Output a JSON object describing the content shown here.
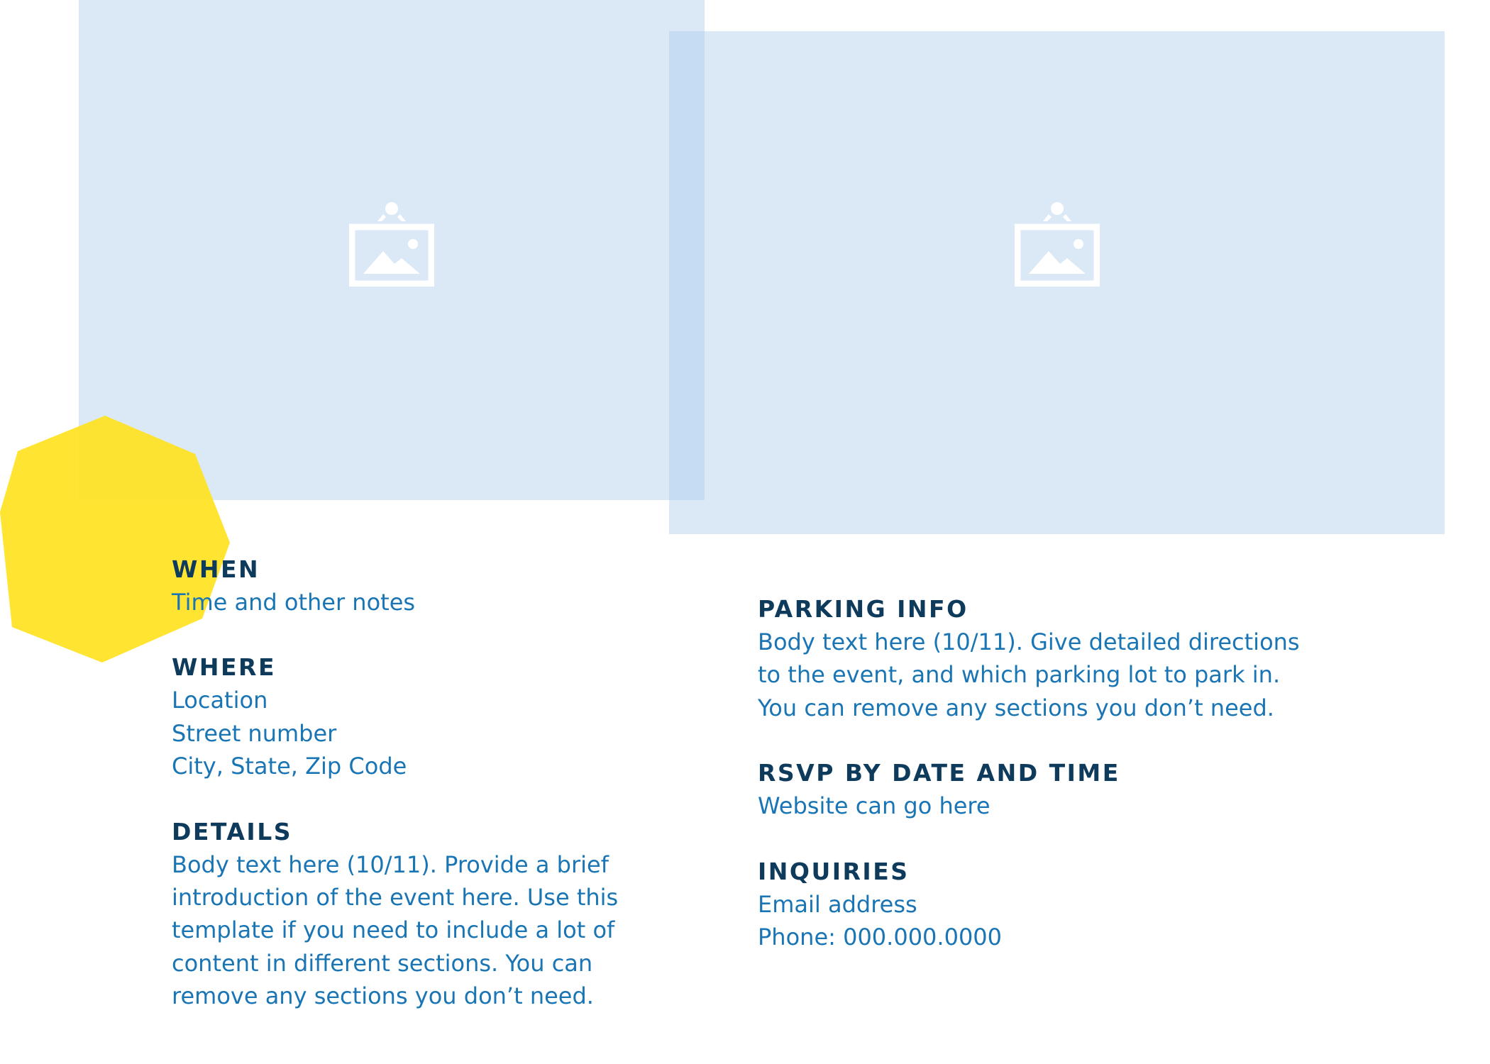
{
  "left_column": {
    "when": {
      "heading": "WHEN",
      "lines": [
        "Time and other notes"
      ]
    },
    "where": {
      "heading": "WHERE",
      "lines": [
        "Location",
        "Street number",
        "City, State, Zip Code"
      ]
    },
    "details": {
      "heading": "DETAILS",
      "lines": [
        "Body text here (10/11). Provide a brief",
        "introduction of the event here. Use this",
        "template if you need to include a lot of",
        "content in different sections. You can",
        "remove any sections you don’t need."
      ]
    }
  },
  "right_column": {
    "parking": {
      "heading": "PARKING INFO",
      "lines": [
        "Body text here (10/11).  Give detailed directions",
        "to the event, and which parking lot to park in.",
        "You can remove any sections you don’t need."
      ]
    },
    "rsvp": {
      "heading": "RSVP BY DATE AND TIME",
      "lines": [
        "Website can go here"
      ]
    },
    "inquiries": {
      "heading": "INQUIRIES",
      "lines": [
        "Email address",
        "Phone: 000.000.0000"
      ]
    }
  },
  "colors": {
    "heading": "#0e3a5c",
    "body": "#1a75b5",
    "photo_placeholder": "#dbe8f5",
    "accent_shape": "#ffe326"
  },
  "icons": {
    "photo_placeholder": "image-placeholder-icon",
    "accent": "yellow-octagon-shape"
  }
}
